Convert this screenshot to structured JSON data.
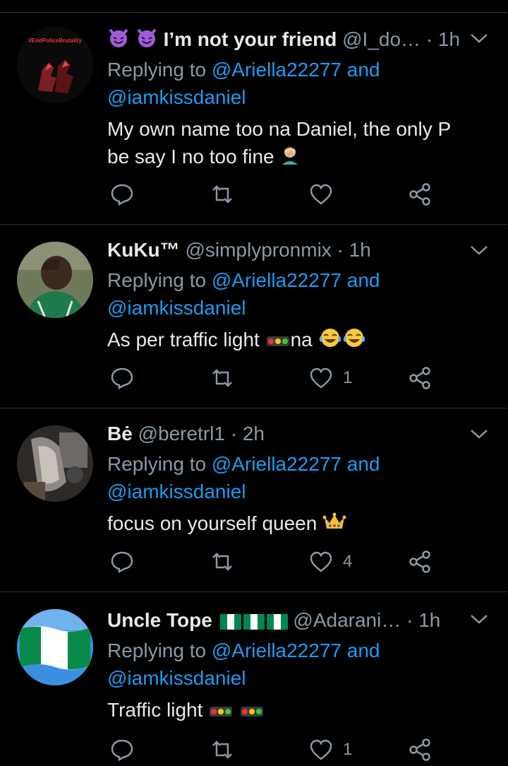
{
  "tweets": [
    {
      "name": "I’m not your friend",
      "handle": "@I_do…",
      "time": "· 1h",
      "reply_prefix": "Replying to",
      "reply_user": "@Ariella22277",
      "reply_and": "and",
      "reply_user2": "@iamkissdaniel",
      "body_line1": "My own name too na Daniel, the only P",
      "body_line2": "be say I no too fine",
      "likes": "",
      "avatar_text": "#EndPoliceBrutality"
    },
    {
      "name": "KuKu™",
      "handle": "@simplypronmix",
      "time": "· 1h",
      "reply_prefix": "Replying to",
      "reply_user": "@Ariella22277",
      "reply_and": "and",
      "reply_user2": "@iamkissdaniel",
      "body_line1a": "As per traffic light",
      "body_line1b": "na",
      "likes": "1"
    },
    {
      "name": "Bė",
      "handle": "@beretrl1",
      "time": "· 2h",
      "reply_prefix": "Replying to",
      "reply_user": "@Ariella22277",
      "reply_and": "and",
      "reply_user2": "@iamkissdaniel",
      "body_line1": "focus on yourself queen",
      "likes": "4"
    },
    {
      "name": "Uncle Tope",
      "handle": "@Adarani…",
      "time": "· 1h",
      "reply_prefix": "Replying to",
      "reply_user": "@Ariella22277",
      "reply_and": "and",
      "reply_user2": "@iamkissdaniel",
      "body_line1": "Traffic light",
      "likes": "1"
    }
  ],
  "colors": {
    "background": "#000000",
    "link": "#1d9bf0",
    "muted": "#8b98a5",
    "text": "#e7e9ea",
    "divider": "#2f3336"
  },
  "icons": [
    "reply-icon",
    "retweet-icon",
    "like-icon",
    "share-icon",
    "chevron-down-icon"
  ]
}
